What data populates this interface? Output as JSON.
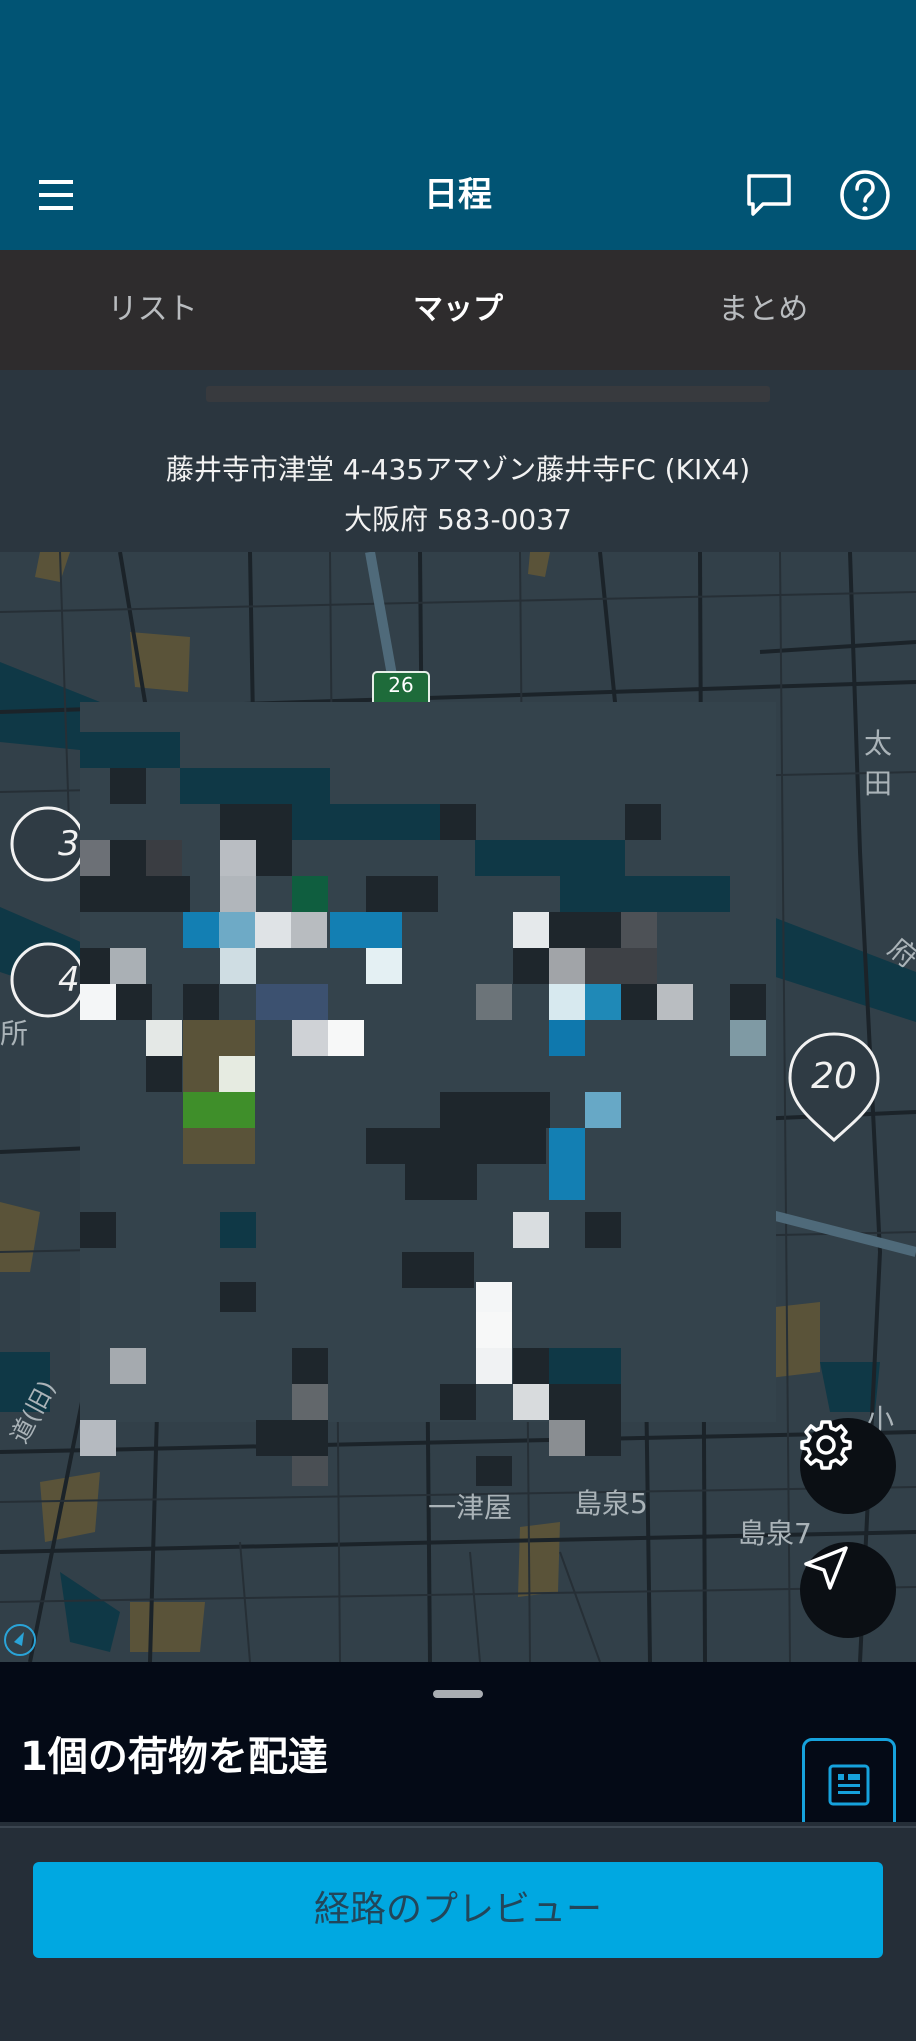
{
  "header": {
    "title": "日程",
    "menu_icon": "hamburger-menu-icon",
    "chat_icon": "chat-bubble-icon",
    "help_icon": "help-circle-icon"
  },
  "tabs": [
    {
      "label": "リスト",
      "active": false
    },
    {
      "label": "マップ",
      "active": true
    },
    {
      "label": "まとめ",
      "active": false
    }
  ],
  "destination": {
    "line1": "藤井寺市津堂 4-435アマゾン藤井寺FC (KIX4)",
    "line2": "大阪府 583-0037"
  },
  "map": {
    "route_shield": "26",
    "labels": {
      "ota": "太田",
      "ichi_tsuya": "一津屋",
      "shimaizumi5": "島泉5",
      "shimaizumi7": "島泉7",
      "koyama": "小山",
      "sho": "所",
      "fu": "府",
      "road": "道(旧)",
      "pin_a": "3",
      "pin_b": "4"
    },
    "stop_marker": "20",
    "settings_icon": "gear-icon",
    "locate_icon": "navigation-arrow-icon",
    "compass_icon": "compass-icon"
  },
  "sheet": {
    "title": "1個の荷物を配達",
    "manifest_icon": "document-list-icon"
  },
  "footer": {
    "preview_button": "経路のプレビュー"
  },
  "colors": {
    "header_bg": "#015474",
    "tab_bar_bg": "#2e2c2d",
    "accent": "#00a8e1",
    "map_bg": "#324049"
  }
}
